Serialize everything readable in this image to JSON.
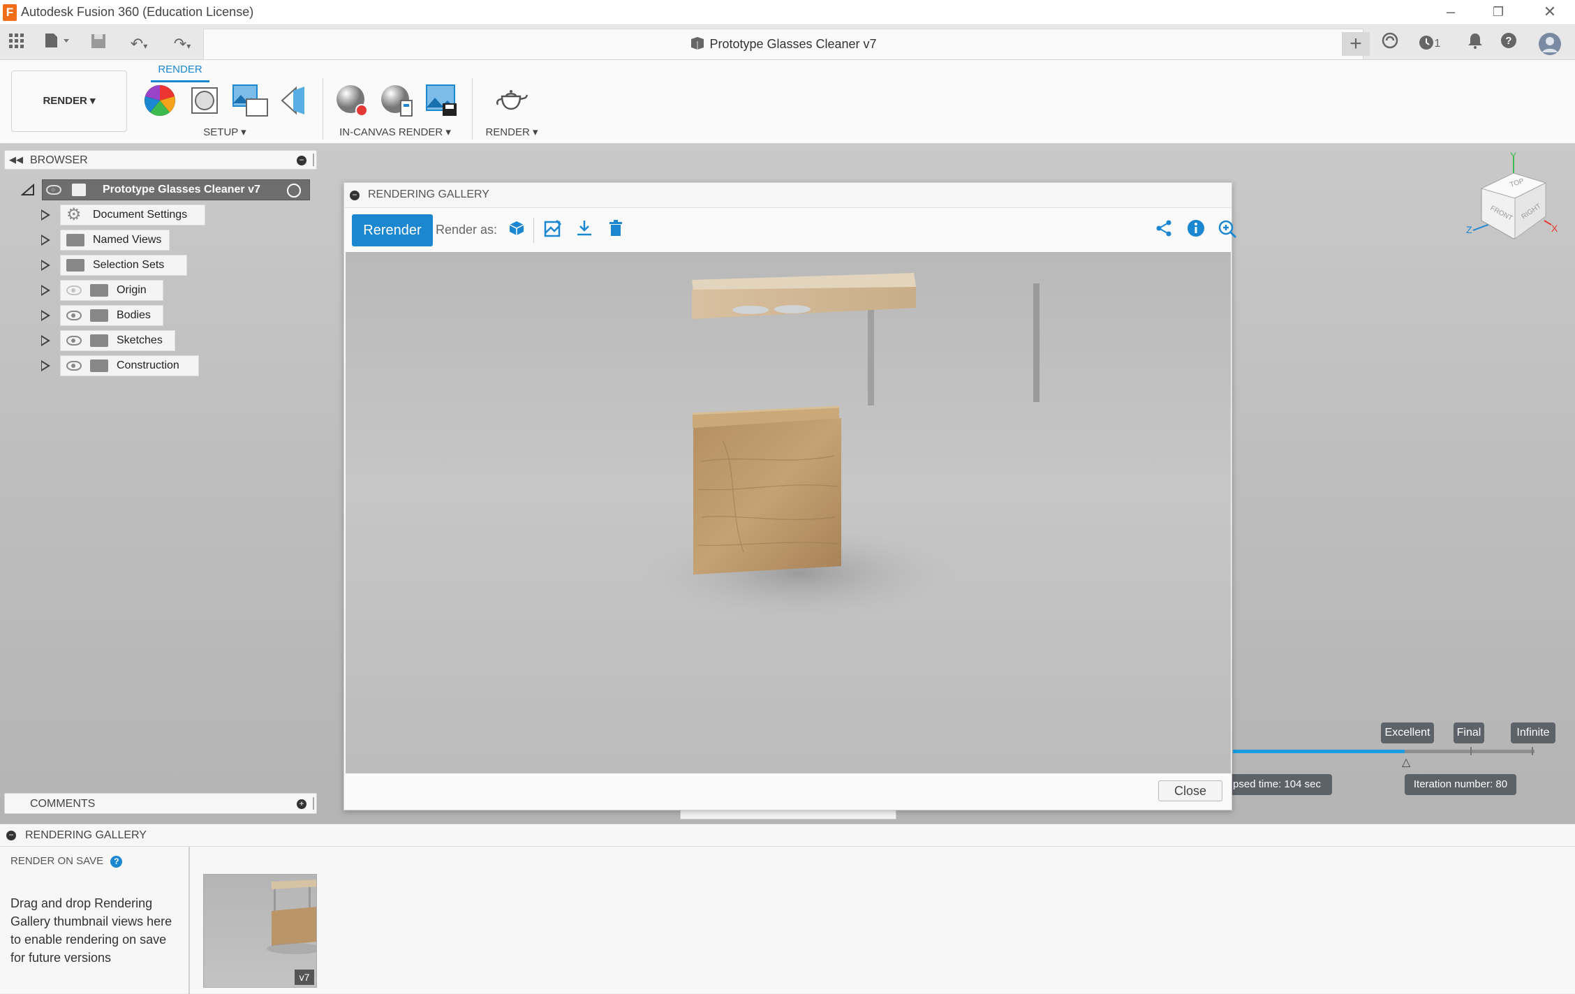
{
  "window": {
    "title": "Autodesk Fusion 360 (Education License)",
    "logo": "F"
  },
  "document_tab": {
    "title": "Prototype Glasses Cleaner v7"
  },
  "quick_access": {
    "notification_count": "1"
  },
  "toolbar": {
    "workspace_label": "RENDER",
    "active_tab": "RENDER",
    "groups": {
      "setup": "SETUP",
      "in_canvas": "IN-CANVAS RENDER",
      "render": "RENDER"
    }
  },
  "browser": {
    "header": "BROWSER",
    "root": "Prototype Glasses Cleaner v7",
    "items": [
      {
        "label": "Document Settings",
        "icon": "gear-icon"
      },
      {
        "label": "Named Views",
        "icon": "folder-icon"
      },
      {
        "label": "Selection Sets",
        "icon": "folder-icon"
      },
      {
        "label": "Origin",
        "icon": "folder-icon",
        "eye": "hidden"
      },
      {
        "label": "Bodies",
        "icon": "folder-icon",
        "eye": "visible"
      },
      {
        "label": "Sketches",
        "icon": "folder-icon",
        "eye": "visible"
      },
      {
        "label": "Construction",
        "icon": "folder-icon",
        "eye": "visible"
      }
    ]
  },
  "gallery_dialog": {
    "header": "RENDERING GALLERY",
    "rerender_label": "Rerender",
    "render_as_label": "Render as:",
    "close_label": "Close"
  },
  "render_status": {
    "quality_levels": [
      "Excellent",
      "Final",
      "Infinite"
    ],
    "elapsed_time": "psed time: 104 sec",
    "iteration": "Iteration number: 80",
    "progress": 0.57
  },
  "viewcube": {
    "faces": [
      "TOP",
      "FRONT",
      "RIGHT"
    ],
    "axes": [
      "Y",
      "Z",
      "X"
    ]
  },
  "comments": {
    "header": "COMMENTS"
  },
  "bottom_gallery": {
    "header": "RENDERING GALLERY",
    "render_on_save": "RENDER ON SAVE",
    "hint": "Drag and drop Rendering Gallery thumbnail views here to enable rendering on save for future versions",
    "thumbnail_version": "v7"
  },
  "colors": {
    "accent": "#1a87d0",
    "wood": "#b99567",
    "pill": "#5d6168"
  }
}
